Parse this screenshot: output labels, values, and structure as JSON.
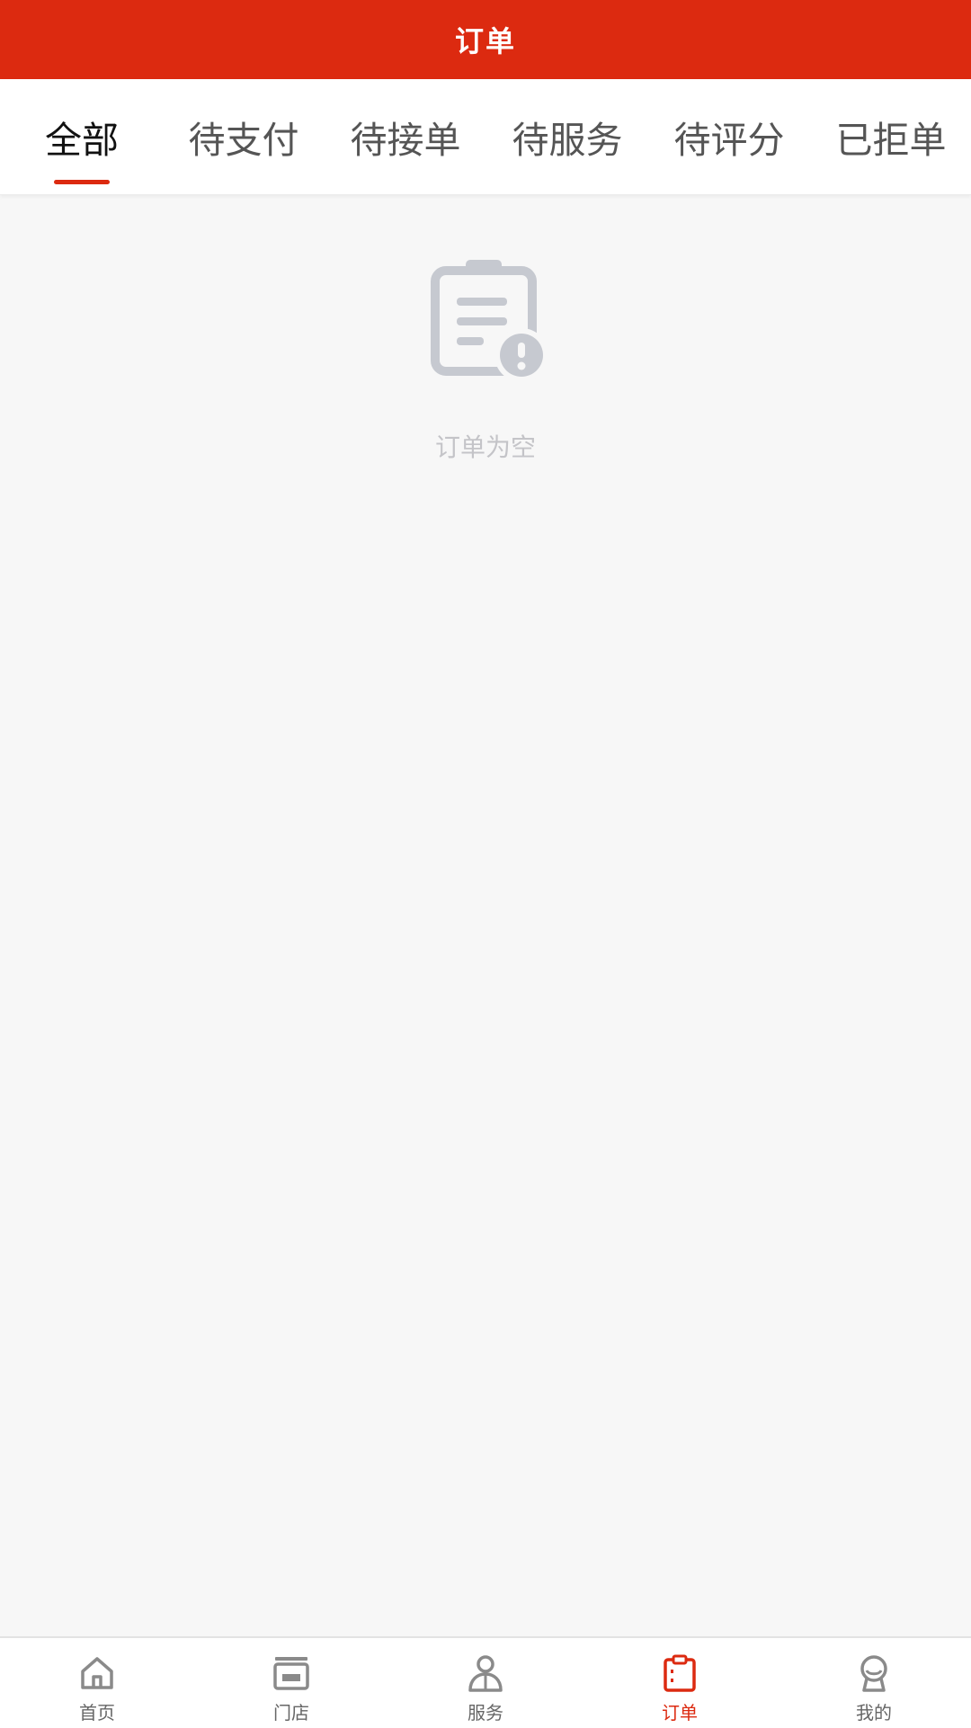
{
  "header": {
    "title": "订单",
    "background_color": "#dc2a10"
  },
  "tabs": {
    "active_index": 0,
    "items": [
      {
        "label": "全部"
      },
      {
        "label": "待支付"
      },
      {
        "label": "待接单"
      },
      {
        "label": "待服务"
      },
      {
        "label": "待评分"
      },
      {
        "label": "已拒单"
      }
    ]
  },
  "empty_state": {
    "icon": "clipboard-alert-icon",
    "text": "订单为空"
  },
  "bottom_nav": {
    "active_index": 3,
    "accent_color": "#dc2a10",
    "items": [
      {
        "label": "首页",
        "icon": "home-icon"
      },
      {
        "label": "门店",
        "icon": "store-icon"
      },
      {
        "label": "服务",
        "icon": "service-person-icon"
      },
      {
        "label": "订单",
        "icon": "order-clipboard-icon"
      },
      {
        "label": "我的",
        "icon": "profile-icon"
      }
    ]
  }
}
